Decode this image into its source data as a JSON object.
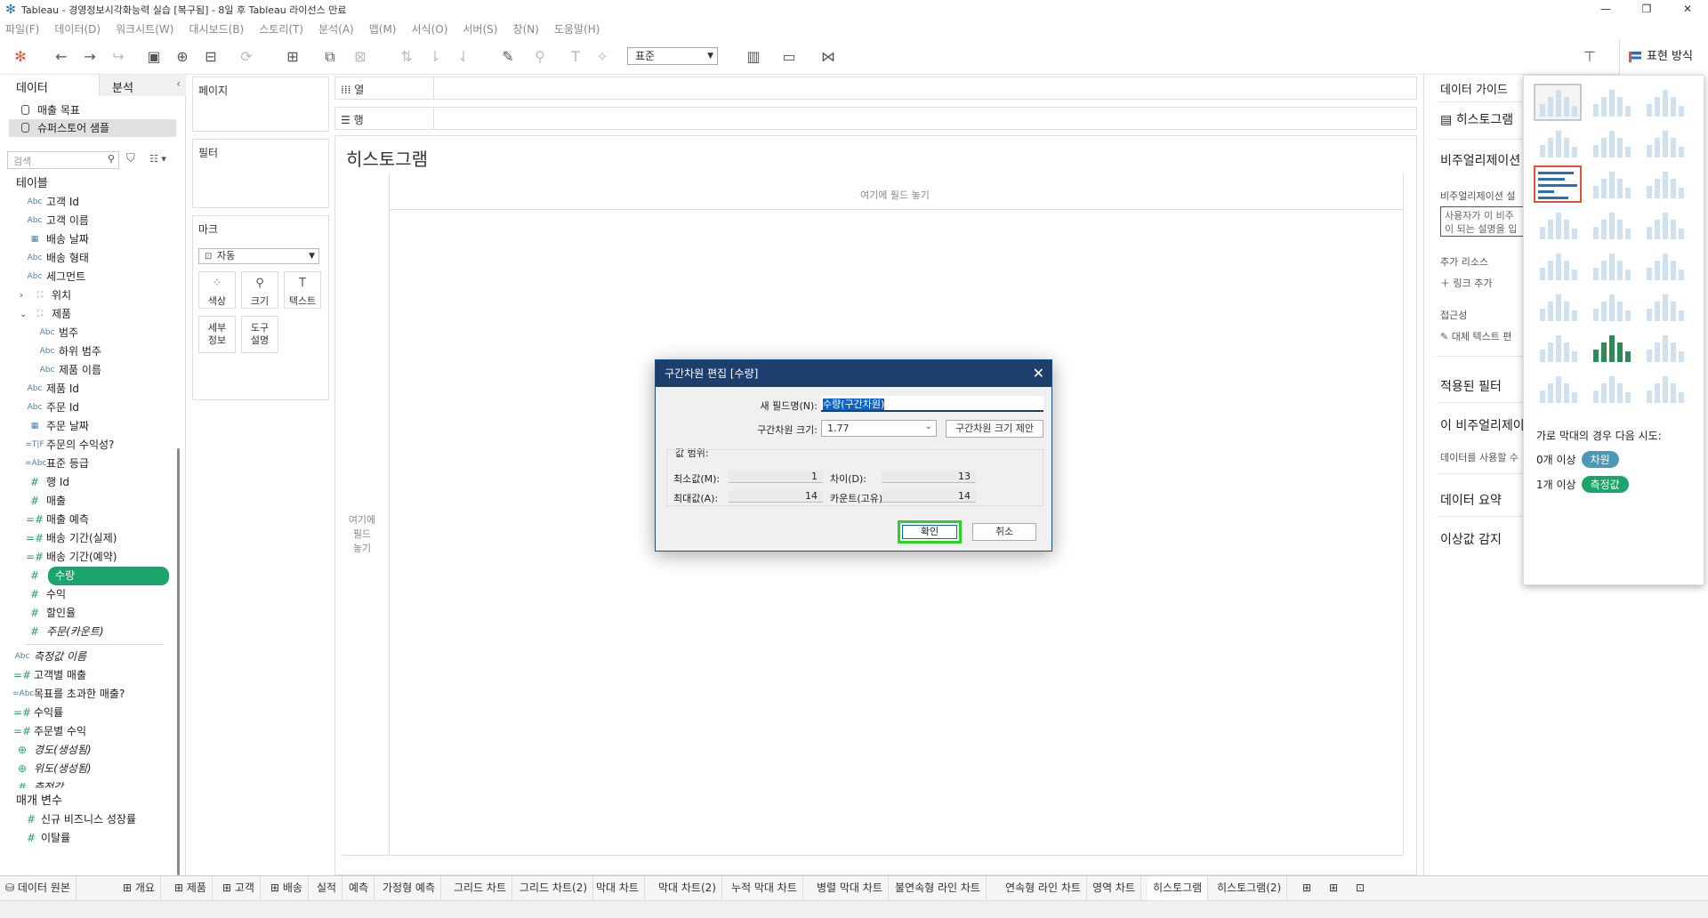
{
  "window": {
    "title": "Tableau - 경영정보시각화능력 실습 [복구됨] - 8일 후 Tableau 라이선스 만료"
  },
  "menu": [
    "파일(F)",
    "데이터(D)",
    "워크시트(W)",
    "대시보드(B)",
    "스토리(T)",
    "분석(A)",
    "맵(M)",
    "서식(O)",
    "서버(S)",
    "창(N)",
    "도움말(H)"
  ],
  "toolbar": {
    "fit_label": "표준",
    "show_me_label": "표현 방식"
  },
  "data_pane": {
    "tab_data": "데이터",
    "tab_analysis": "분석",
    "sources": [
      "매출 목표",
      "슈퍼스토어 샘플"
    ],
    "search_placeholder": "검색",
    "tables_header": "테이블",
    "fields": [
      {
        "icon": "Abc",
        "label": "고객 Id"
      },
      {
        "icon": "Abc",
        "label": "고객 이름"
      },
      {
        "icon": "cal",
        "label": "배송 날짜"
      },
      {
        "icon": "Abc",
        "label": "배송 형태"
      },
      {
        "icon": "Abc",
        "label": "세그먼트"
      },
      {
        "icon": "geo",
        "label": "위치"
      },
      {
        "icon": "geo",
        "label": "제품"
      },
      {
        "icon": "Abc",
        "label": "범주"
      },
      {
        "icon": "Abc",
        "label": "하위 범주"
      },
      {
        "icon": "Abc",
        "label": "제품 이름"
      },
      {
        "icon": "Abc",
        "label": "제품 Id"
      },
      {
        "icon": "Abc",
        "label": "주문 Id"
      },
      {
        "icon": "cal",
        "label": "주문 날짜"
      },
      {
        "icon": "=T|F",
        "label": "주문의 수익성?"
      },
      {
        "icon": "=Abc",
        "label": "표준 등급"
      },
      {
        "icon": "#",
        "label": "행 Id"
      },
      {
        "icon": "#",
        "label": "매출"
      },
      {
        "icon": "=#",
        "label": "매출 예측"
      },
      {
        "icon": "=#",
        "label": "배송 기간(실제)"
      },
      {
        "icon": "=#",
        "label": "배송 기간(예약)"
      },
      {
        "icon": "#",
        "label": "수량"
      },
      {
        "icon": "#",
        "label": "수익"
      },
      {
        "icon": "#",
        "label": "할인율"
      },
      {
        "icon": "#",
        "label": "주문(카운트)"
      },
      {
        "icon": "Abc",
        "label": "측정값 이름"
      },
      {
        "icon": "=#",
        "label": "고객별 매출"
      },
      {
        "icon": "=Abc",
        "label": "목표를 초과한 매출?"
      },
      {
        "icon": "=#",
        "label": "수익률"
      },
      {
        "icon": "=#",
        "label": "주문별 수익"
      },
      {
        "icon": "globe",
        "label": "경도(생성됨)"
      },
      {
        "icon": "globe",
        "label": "위도(생성됨)"
      },
      {
        "icon": "#",
        "label": "측정값"
      }
    ],
    "params_header": "매개 변수",
    "params": [
      "신규 비즈니스 성장률",
      "이탈률"
    ]
  },
  "cards": {
    "pages": "페이지",
    "filters": "필터",
    "marks": "마크",
    "marks_type": "자동",
    "color": "색상",
    "size": "크기",
    "text": "텍스트",
    "detail": "세부\n정보",
    "tooltip": "도구\n설명"
  },
  "shelves": {
    "columns": "열",
    "rows": "행"
  },
  "sheet": {
    "title": "히스토그램",
    "drop_top": "여기에 필드 놓기",
    "drop_left": "여기에\n필드\n놓기"
  },
  "guide": {
    "header": "데이터 가이드",
    "chart": "히스토그램",
    "viz_desc_header": "비주얼리제이션",
    "viz_desc_sub": "비주얼리제이션 설",
    "viz_desc_box": "사용자가 이 비주\n이 되는 설명을 입",
    "resources": "추가 리소스",
    "add_link": "링크 추가",
    "accessibility": "접근성",
    "alt_text": "대체 텍스트 편",
    "applied_filters": "적용된 필터",
    "this_viz": "이 비주얼리제이",
    "use_data": "데이터를 사용할 수",
    "data_summary": "데이터 요약",
    "outliers": "이상값 감지"
  },
  "show_me": {
    "hint": "가로 막대의 경우 다음 시도:",
    "req1_prefix": "0개 이상",
    "req1_pill": "차원",
    "req2_prefix": "1개 이상",
    "req2_pill": "측정값",
    "dim_color": "#4f98b5",
    "measure_color": "#1aa56d"
  },
  "dialog": {
    "title": "구간차원 편집 [수량]",
    "new_field_label": "새 필드명(N):",
    "new_field_value": "수량(구간차원)",
    "bin_size_label": "구간차원 크기:",
    "bin_size_value": "1.77",
    "suggest_button": "구간차원 크기 제안",
    "range_label": "값 범위:",
    "min_label": "최소값(M):",
    "min_value": "1",
    "diff_label": "차이(D):",
    "diff_value": "13",
    "max_label": "최대값(A):",
    "max_value": "14",
    "count_label": "카운트(고유):",
    "count_value": "14",
    "ok": "확인",
    "cancel": "취소"
  },
  "sheet_tabs": [
    {
      "label": "데이터 원본",
      "icon": "cyl"
    },
    {
      "label": "개요",
      "icon": "grid"
    },
    {
      "label": "제품",
      "icon": "grid"
    },
    {
      "label": "고객",
      "icon": "grid"
    },
    {
      "label": "배송",
      "icon": "grid"
    },
    {
      "label": "실적"
    },
    {
      "label": "예측"
    },
    {
      "label": "가정형 예측"
    },
    {
      "label": "그리드 차트"
    },
    {
      "label": "그리드 차트(2)"
    },
    {
      "label": "막대 차트"
    },
    {
      "label": "막대 차트(2)"
    },
    {
      "label": "누적 막대 차트"
    },
    {
      "label": "병렬 막대 차트"
    },
    {
      "label": "불연속형 라인 차트"
    },
    {
      "label": "연속형 라인 차트"
    },
    {
      "label": "영역 차트"
    },
    {
      "label": "히스토그램",
      "active": true
    },
    {
      "label": "히스토그램(2)"
    }
  ]
}
